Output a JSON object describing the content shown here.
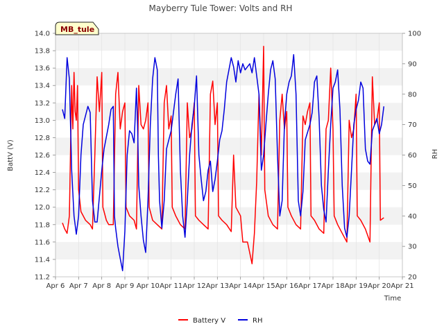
{
  "chart_data": {
    "type": "line",
    "title": "Mayberry Tule Tower: Volts and RH",
    "badge": "MB_tule",
    "xlabel": "Time",
    "ylabel_left": "BattV (V)",
    "ylabel_right": "RH",
    "x_ticks": [
      "Apr 6",
      "Apr 7",
      "Apr 8",
      "Apr 9",
      "Apr 10",
      "Apr 11",
      "Apr 12",
      "Apr 13",
      "Apr 14",
      "Apr 15",
      "Apr 16",
      "Apr 17",
      "Apr 18",
      "Apr 19",
      "Apr 20",
      "Apr 21"
    ],
    "x_range": [
      6,
      21
    ],
    "ylim_left": [
      11.2,
      14.0
    ],
    "ylim_right": [
      20,
      100
    ],
    "y_ticks_left": [
      "11.2",
      "11.4",
      "11.6",
      "11.8",
      "12.0",
      "12.2",
      "12.4",
      "12.6",
      "12.8",
      "13.0",
      "13.2",
      "13.4",
      "13.6",
      "13.8",
      "14.0"
    ],
    "y_ticks_right": [
      "20",
      "30",
      "40",
      "50",
      "60",
      "70",
      "80",
      "90",
      "100"
    ],
    "grid": true,
    "legend_position": "bottom-center",
    "colors": {
      "battery": "#ff0000",
      "rh": "#0000dd",
      "band": "#f2f2f2"
    },
    "series": [
      {
        "name": "Battery V",
        "axis": "left",
        "points": [
          [
            6.3,
            11.82
          ],
          [
            6.4,
            11.75
          ],
          [
            6.5,
            11.7
          ],
          [
            6.6,
            11.9
          ],
          [
            6.7,
            13.4
          ],
          [
            6.75,
            12.9
          ],
          [
            6.8,
            13.55
          ],
          [
            6.85,
            13.1
          ],
          [
            6.9,
            13.0
          ],
          [
            6.95,
            13.4
          ],
          [
            7.0,
            12.2
          ],
          [
            7.1,
            11.95
          ],
          [
            7.3,
            11.85
          ],
          [
            7.5,
            11.8
          ],
          [
            7.6,
            11.75
          ],
          [
            7.7,
            12.6
          ],
          [
            7.8,
            13.5
          ],
          [
            7.9,
            13.1
          ],
          [
            8.0,
            13.55
          ],
          [
            8.05,
            12.0
          ],
          [
            8.1,
            11.95
          ],
          [
            8.2,
            11.85
          ],
          [
            8.3,
            11.8
          ],
          [
            8.5,
            11.8
          ],
          [
            8.6,
            13.3
          ],
          [
            8.7,
            13.55
          ],
          [
            8.8,
            12.9
          ],
          [
            8.9,
            13.1
          ],
          [
            9.0,
            13.2
          ],
          [
            9.05,
            12.0
          ],
          [
            9.2,
            11.9
          ],
          [
            9.4,
            11.85
          ],
          [
            9.5,
            11.75
          ],
          [
            9.6,
            13.4
          ],
          [
            9.7,
            12.95
          ],
          [
            9.8,
            12.9
          ],
          [
            9.9,
            13.0
          ],
          [
            10.0,
            13.2
          ],
          [
            10.05,
            12.0
          ],
          [
            10.2,
            11.85
          ],
          [
            10.4,
            11.8
          ],
          [
            10.6,
            11.75
          ],
          [
            10.7,
            13.2
          ],
          [
            10.8,
            13.4
          ],
          [
            10.9,
            12.9
          ],
          [
            11.0,
            13.05
          ],
          [
            11.05,
            12.0
          ],
          [
            11.2,
            11.9
          ],
          [
            11.4,
            11.8
          ],
          [
            11.6,
            11.75
          ],
          [
            11.7,
            13.2
          ],
          [
            11.8,
            12.8
          ],
          [
            11.9,
            12.9
          ],
          [
            12.0,
            13.2
          ],
          [
            12.05,
            11.9
          ],
          [
            12.2,
            11.85
          ],
          [
            12.4,
            11.8
          ],
          [
            12.6,
            11.75
          ],
          [
            12.7,
            13.3
          ],
          [
            12.8,
            13.45
          ],
          [
            12.9,
            12.95
          ],
          [
            13.0,
            13.2
          ],
          [
            13.05,
            11.9
          ],
          [
            13.2,
            11.85
          ],
          [
            13.4,
            11.8
          ],
          [
            13.6,
            11.72
          ],
          [
            13.7,
            12.6
          ],
          [
            13.8,
            12.0
          ],
          [
            14.0,
            11.9
          ],
          [
            14.1,
            11.6
          ],
          [
            14.3,
            11.6
          ],
          [
            14.5,
            11.35
          ],
          [
            14.6,
            11.7
          ],
          [
            14.7,
            12.3
          ],
          [
            14.8,
            13.3
          ],
          [
            14.9,
            12.6
          ],
          [
            15.0,
            13.85
          ],
          [
            15.05,
            12.2
          ],
          [
            15.2,
            11.9
          ],
          [
            15.4,
            11.8
          ],
          [
            15.6,
            11.75
          ],
          [
            15.7,
            13.0
          ],
          [
            15.8,
            13.3
          ],
          [
            15.9,
            12.9
          ],
          [
            16.0,
            13.1
          ],
          [
            16.05,
            12.0
          ],
          [
            16.2,
            11.9
          ],
          [
            16.4,
            11.8
          ],
          [
            16.6,
            11.75
          ],
          [
            16.7,
            13.05
          ],
          [
            16.8,
            12.95
          ],
          [
            16.9,
            13.1
          ],
          [
            17.0,
            13.2
          ],
          [
            17.05,
            11.9
          ],
          [
            17.2,
            11.85
          ],
          [
            17.4,
            11.75
          ],
          [
            17.6,
            11.7
          ],
          [
            17.7,
            12.9
          ],
          [
            17.8,
            13.0
          ],
          [
            17.9,
            13.6
          ],
          [
            18.0,
            12.9
          ],
          [
            18.05,
            11.9
          ],
          [
            18.2,
            11.8
          ],
          [
            18.4,
            11.7
          ],
          [
            18.6,
            11.6
          ],
          [
            18.7,
            13.0
          ],
          [
            18.8,
            12.8
          ],
          [
            18.9,
            12.9
          ],
          [
            19.0,
            13.3
          ],
          [
            19.05,
            11.9
          ],
          [
            19.2,
            11.85
          ],
          [
            19.4,
            11.75
          ],
          [
            19.6,
            11.6
          ],
          [
            19.7,
            13.5
          ],
          [
            19.8,
            12.95
          ],
          [
            19.9,
            13.0
          ],
          [
            20.0,
            13.2
          ],
          [
            20.05,
            11.85
          ],
          [
            20.2,
            11.88
          ]
        ]
      },
      {
        "name": "RH",
        "axis": "right",
        "points": [
          [
            6.3,
            75
          ],
          [
            6.4,
            72
          ],
          [
            6.5,
            92
          ],
          [
            6.6,
            85
          ],
          [
            6.7,
            55
          ],
          [
            6.8,
            40
          ],
          [
            6.9,
            34
          ],
          [
            7.0,
            40
          ],
          [
            7.1,
            60
          ],
          [
            7.2,
            70
          ],
          [
            7.4,
            76
          ],
          [
            7.5,
            74
          ],
          [
            7.6,
            45
          ],
          [
            7.7,
            38
          ],
          [
            7.8,
            38
          ],
          [
            8.0,
            55
          ],
          [
            8.1,
            62
          ],
          [
            8.3,
            70
          ],
          [
            8.4,
            75
          ],
          [
            8.5,
            76
          ],
          [
            8.55,
            40
          ],
          [
            8.6,
            36
          ],
          [
            8.7,
            30
          ],
          [
            8.8,
            26
          ],
          [
            8.9,
            22
          ],
          [
            9.0,
            35
          ],
          [
            9.1,
            60
          ],
          [
            9.2,
            68
          ],
          [
            9.3,
            67
          ],
          [
            9.4,
            64
          ],
          [
            9.5,
            82
          ],
          [
            9.55,
            70
          ],
          [
            9.6,
            50
          ],
          [
            9.7,
            40
          ],
          [
            9.8,
            32
          ],
          [
            9.9,
            28
          ],
          [
            10.0,
            45
          ],
          [
            10.1,
            70
          ],
          [
            10.2,
            85
          ],
          [
            10.3,
            92
          ],
          [
            10.4,
            88
          ],
          [
            10.45,
            60
          ],
          [
            10.5,
            45
          ],
          [
            10.6,
            36
          ],
          [
            10.7,
            45
          ],
          [
            10.8,
            62
          ],
          [
            11.0,
            68
          ],
          [
            11.2,
            80
          ],
          [
            11.3,
            85
          ],
          [
            11.4,
            55
          ],
          [
            11.5,
            40
          ],
          [
            11.6,
            33
          ],
          [
            11.7,
            45
          ],
          [
            11.8,
            60
          ],
          [
            11.9,
            70
          ],
          [
            12.0,
            76
          ],
          [
            12.1,
            86
          ],
          [
            12.2,
            60
          ],
          [
            12.3,
            52
          ],
          [
            12.4,
            45
          ],
          [
            12.5,
            48
          ],
          [
            12.6,
            55
          ],
          [
            12.7,
            58
          ],
          [
            12.8,
            48
          ],
          [
            12.9,
            52
          ],
          [
            13.0,
            58
          ],
          [
            13.1,
            65
          ],
          [
            13.2,
            68
          ],
          [
            13.3,
            75
          ],
          [
            13.4,
            84
          ],
          [
            13.5,
            88
          ],
          [
            13.6,
            92
          ],
          [
            13.7,
            89
          ],
          [
            13.8,
            84
          ],
          [
            13.9,
            91
          ],
          [
            14.0,
            87
          ],
          [
            14.1,
            90
          ],
          [
            14.2,
            88
          ],
          [
            14.4,
            90
          ],
          [
            14.5,
            87
          ],
          [
            14.6,
            92
          ],
          [
            14.7,
            86
          ],
          [
            14.8,
            80
          ],
          [
            14.9,
            55
          ],
          [
            15.0,
            60
          ],
          [
            15.1,
            70
          ],
          [
            15.2,
            80
          ],
          [
            15.3,
            88
          ],
          [
            15.4,
            91
          ],
          [
            15.5,
            85
          ],
          [
            15.6,
            60
          ],
          [
            15.7,
            40
          ],
          [
            15.8,
            45
          ],
          [
            15.9,
            70
          ],
          [
            16.0,
            80
          ],
          [
            16.1,
            84
          ],
          [
            16.2,
            86
          ],
          [
            16.3,
            93
          ],
          [
            16.4,
            80
          ],
          [
            16.5,
            45
          ],
          [
            16.6,
            40
          ],
          [
            16.7,
            48
          ],
          [
            16.8,
            65
          ],
          [
            17.0,
            70
          ],
          [
            17.1,
            74
          ],
          [
            17.2,
            84
          ],
          [
            17.3,
            86
          ],
          [
            17.4,
            72
          ],
          [
            17.5,
            50
          ],
          [
            17.6,
            42
          ],
          [
            17.7,
            38
          ],
          [
            17.8,
            55
          ],
          [
            17.9,
            70
          ],
          [
            18.0,
            82
          ],
          [
            18.1,
            84
          ],
          [
            18.2,
            88
          ],
          [
            18.3,
            75
          ],
          [
            18.4,
            50
          ],
          [
            18.5,
            36
          ],
          [
            18.6,
            33
          ],
          [
            18.7,
            40
          ],
          [
            18.8,
            55
          ],
          [
            18.9,
            70
          ],
          [
            19.0,
            75
          ],
          [
            19.1,
            78
          ],
          [
            19.2,
            84
          ],
          [
            19.3,
            82
          ],
          [
            19.4,
            62
          ],
          [
            19.5,
            58
          ],
          [
            19.6,
            57
          ],
          [
            19.7,
            68
          ],
          [
            19.8,
            70
          ],
          [
            19.9,
            72
          ],
          [
            20.0,
            67
          ],
          [
            20.1,
            70
          ],
          [
            20.2,
            76
          ]
        ]
      }
    ]
  }
}
